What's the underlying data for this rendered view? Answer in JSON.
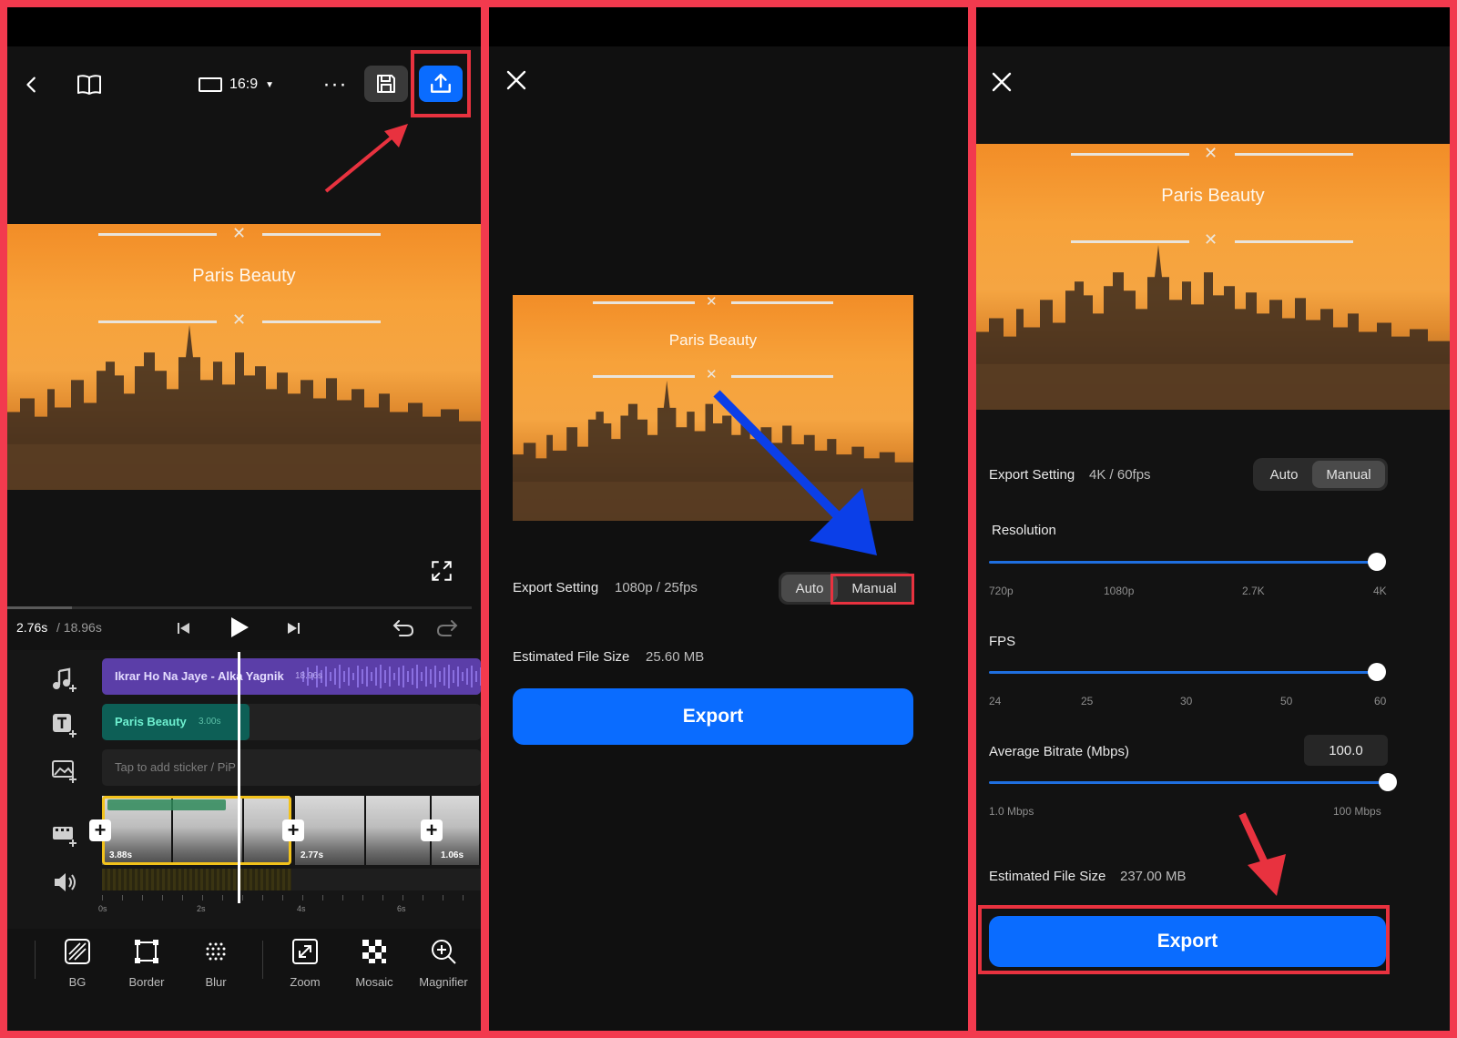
{
  "panel1": {
    "aspect": "16:9",
    "video_title": "Paris Beauty",
    "timecode_current": "2.76s",
    "timecode_total": "/ 18.96s",
    "music_track": {
      "label": "Ikrar Ho Na Jaye - Alka Yagnik",
      "duration": "18.96s"
    },
    "text_track": {
      "label": "Paris Beauty",
      "duration": "3.00s"
    },
    "sticker_placeholder": "Tap to add sticker / PiP",
    "clips": [
      {
        "duration": "3.88s"
      },
      {
        "duration": "2.77s"
      },
      {
        "duration": "1.06s"
      }
    ],
    "ruler": [
      "0s",
      "2s",
      "4s",
      "6s"
    ],
    "tools": [
      {
        "label": "BG",
        "icon": "bg-icon"
      },
      {
        "label": "Border",
        "icon": "border-icon"
      },
      {
        "label": "Blur",
        "icon": "blur-icon"
      },
      {
        "label": "Zoom",
        "icon": "zoom-icon"
      },
      {
        "label": "Mosaic",
        "icon": "mosaic-icon"
      },
      {
        "label": "Magnifier",
        "icon": "magnifier-icon"
      }
    ]
  },
  "panel2": {
    "video_title": "Paris Beauty",
    "export_setting_label": "Export Setting",
    "export_setting_value": "1080p / 25fps",
    "mode_auto": "Auto",
    "mode_manual": "Manual",
    "file_size_label": "Estimated File Size",
    "file_size_value": "25.60 MB",
    "export_label": "Export"
  },
  "panel3": {
    "video_title": "Paris Beauty",
    "export_setting_label": "Export Setting",
    "export_setting_value": "4K / 60fps",
    "mode_auto": "Auto",
    "mode_manual": "Manual",
    "resolution_label": "Resolution",
    "resolution_ticks": [
      "720p",
      "1080p",
      "2.7K",
      "4K"
    ],
    "resolution_value": "4K",
    "fps_label": "FPS",
    "fps_ticks": [
      "24",
      "25",
      "30",
      "50",
      "60"
    ],
    "fps_value": "60",
    "bitrate_label": "Average Bitrate (Mbps)",
    "bitrate_value": "100.0",
    "bitrate_min": "1.0 Mbps",
    "bitrate_max": "100 Mbps",
    "file_size_label": "Estimated File Size",
    "file_size_value": "237.00 MB",
    "export_label": "Export"
  },
  "colors": {
    "accent": "#0a6cff",
    "highlight": "#e8323f",
    "annotation_arrow_blue": "#0b3fe8"
  }
}
